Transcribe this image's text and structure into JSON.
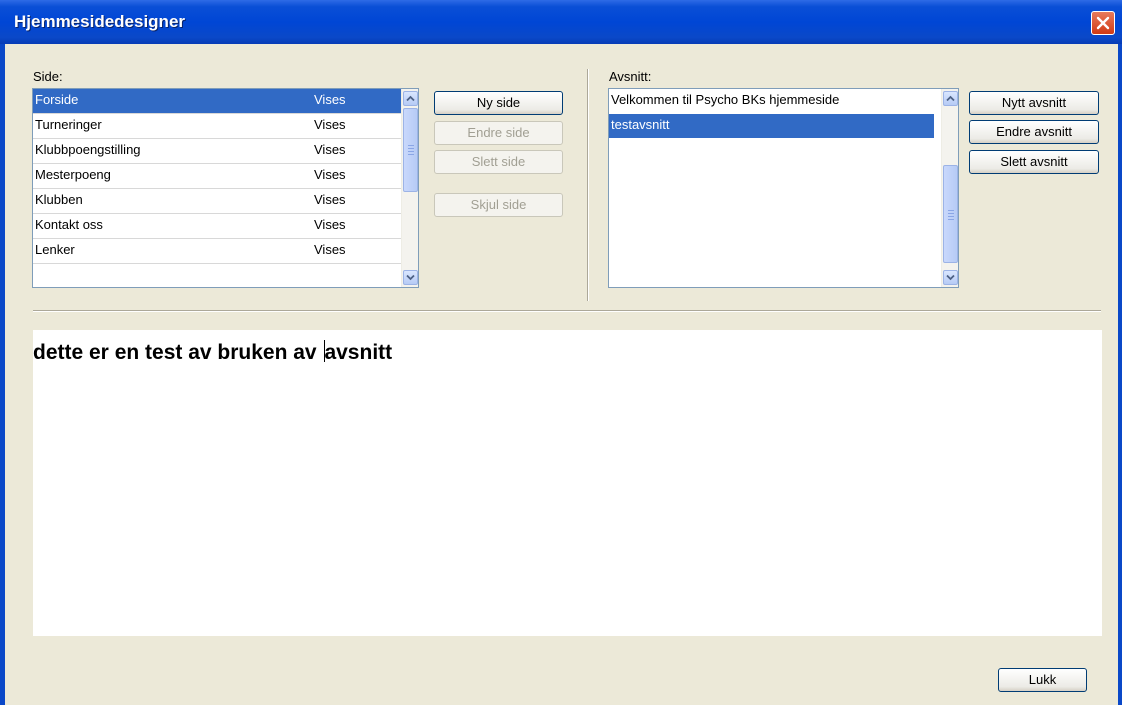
{
  "window": {
    "title": "Hjemmesidedesigner"
  },
  "side": {
    "label": "Side:",
    "rows": [
      {
        "name": "Forside",
        "status": "Vises"
      },
      {
        "name": "Turneringer",
        "status": "Vises"
      },
      {
        "name": "Klubbpoengstilling",
        "status": "Vises"
      },
      {
        "name": "Mesterpoeng",
        "status": "Vises"
      },
      {
        "name": "Klubben",
        "status": "Vises"
      },
      {
        "name": "Kontakt oss",
        "status": "Vises"
      },
      {
        "name": "Lenker",
        "status": "Vises"
      }
    ],
    "selected_index": 0,
    "buttons": {
      "new": "Ny side",
      "edit": "Endre side",
      "delete": "Slett side",
      "hide": "Skjul side"
    }
  },
  "avsnitt": {
    "label": "Avsnitt:",
    "rows": [
      {
        "name": "Velkommen til Psycho BKs hjemmeside"
      },
      {
        "name": "testavsnitt"
      }
    ],
    "selected_index": 1,
    "buttons": {
      "new": "Nytt avsnitt",
      "edit": "Endre avsnitt",
      "delete": "Slett avsnitt"
    }
  },
  "editor": {
    "text_before_caret": "dette er en test av bruken av ",
    "text_after_caret": "avsnitt"
  },
  "footer": {
    "close_label": "Lukk"
  },
  "colors": {
    "titlebar": "#0046D5",
    "selection": "#316AC5",
    "dialog_bg": "#ECE9D8",
    "close_button": "#D23A14"
  }
}
